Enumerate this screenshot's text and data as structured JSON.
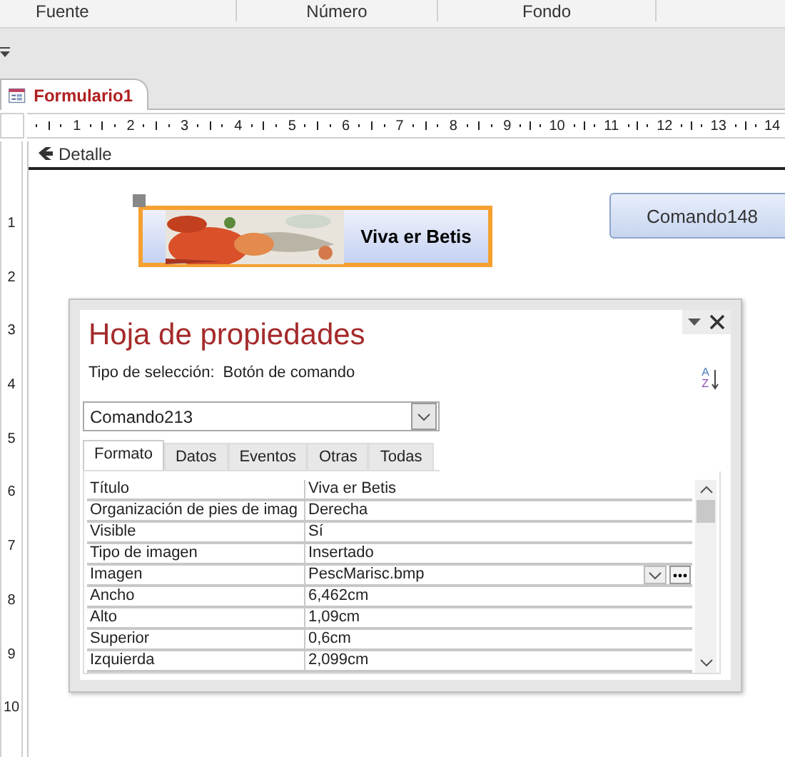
{
  "ribbon": {
    "groups": [
      "Fuente",
      "Número",
      "Fondo"
    ]
  },
  "document_tab": {
    "label": "Formulario1",
    "selected": true
  },
  "ruler": {
    "marks": [
      "1",
      "2",
      "3",
      "4",
      "5",
      "6",
      "7",
      "8",
      "9",
      "10",
      "11",
      "12",
      "13",
      "14"
    ]
  },
  "vertical_ruler": {
    "marks": [
      "1",
      "2",
      "3",
      "4",
      "5",
      "6",
      "7",
      "8",
      "9",
      "10"
    ]
  },
  "section": {
    "label": "Detalle"
  },
  "controls": [
    {
      "kind": "picture_button",
      "caption": "Viva er Betis",
      "selected": true
    },
    {
      "kind": "button",
      "caption": "Comando148",
      "selected": false
    }
  ],
  "property_sheet": {
    "title": "Hoja de propiedades",
    "selection_type_label": "Tipo de selección:",
    "selection_type": "Botón de comando",
    "object": "Comando213",
    "sort_letters": [
      "A",
      "Z"
    ],
    "tabs": [
      {
        "label": "Formato",
        "selected": true
      },
      {
        "label": "Datos",
        "selected": false
      },
      {
        "label": "Eventos",
        "selected": false
      },
      {
        "label": "Otras",
        "selected": false
      },
      {
        "label": "Todas",
        "selected": false
      }
    ],
    "rows": [
      {
        "name": "Título",
        "value": "Viva er Betis",
        "builder": false
      },
      {
        "name": "Organización de pies de imag",
        "value": "Derecha",
        "builder": false
      },
      {
        "name": "Visible",
        "value": "Sí",
        "builder": false
      },
      {
        "name": "Tipo de imagen",
        "value": "Insertado",
        "builder": false
      },
      {
        "name": "Imagen",
        "value": "PescMarisc.bmp",
        "builder": true
      },
      {
        "name": "Ancho",
        "value": "6,462cm",
        "builder": false
      },
      {
        "name": "Alto",
        "value": "1,09cm",
        "builder": false
      },
      {
        "name": "Superior",
        "value": "0,6cm",
        "builder": false
      },
      {
        "name": "Izquierda",
        "value": "2,099cm",
        "builder": false
      }
    ]
  }
}
